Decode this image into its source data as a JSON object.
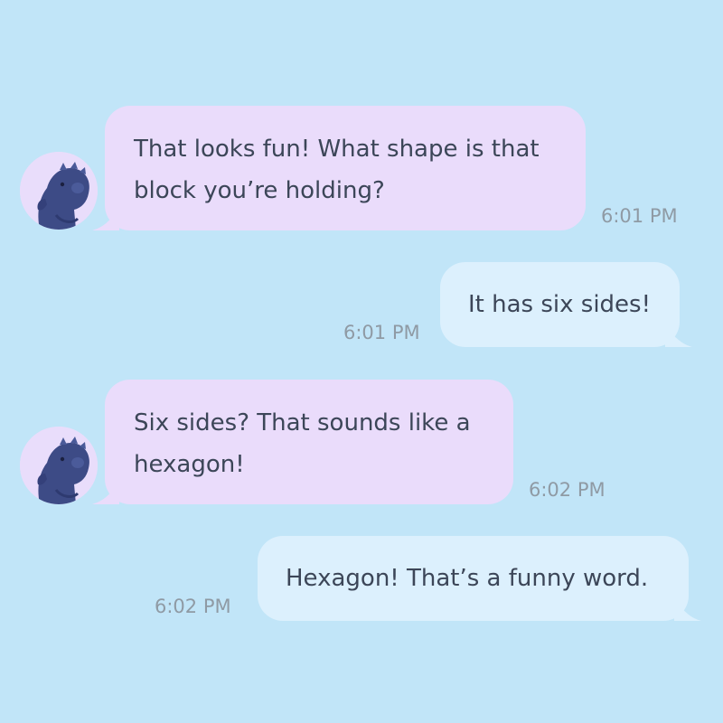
{
  "colors": {
    "background": "#c1e5f8",
    "incoming_bubble": "#eadcfb",
    "outgoing_bubble": "#dcf0fd",
    "text": "#3c4658",
    "timestamp": "#8f9aa4"
  },
  "avatar_icon": "dinosaur-plush-avatar",
  "messages": [
    {
      "direction": "incoming",
      "text": "That looks fun! What shape is that block you’re holding?",
      "time": "6:01 PM"
    },
    {
      "direction": "outgoing",
      "text": "It has six sides!",
      "time": "6:01 PM"
    },
    {
      "direction": "incoming",
      "text": "Six sides? That sounds like a hexagon!",
      "time": "6:02 PM"
    },
    {
      "direction": "outgoing",
      "text": "Hexagon! That’s a funny word.",
      "time": "6:02 PM"
    }
  ]
}
